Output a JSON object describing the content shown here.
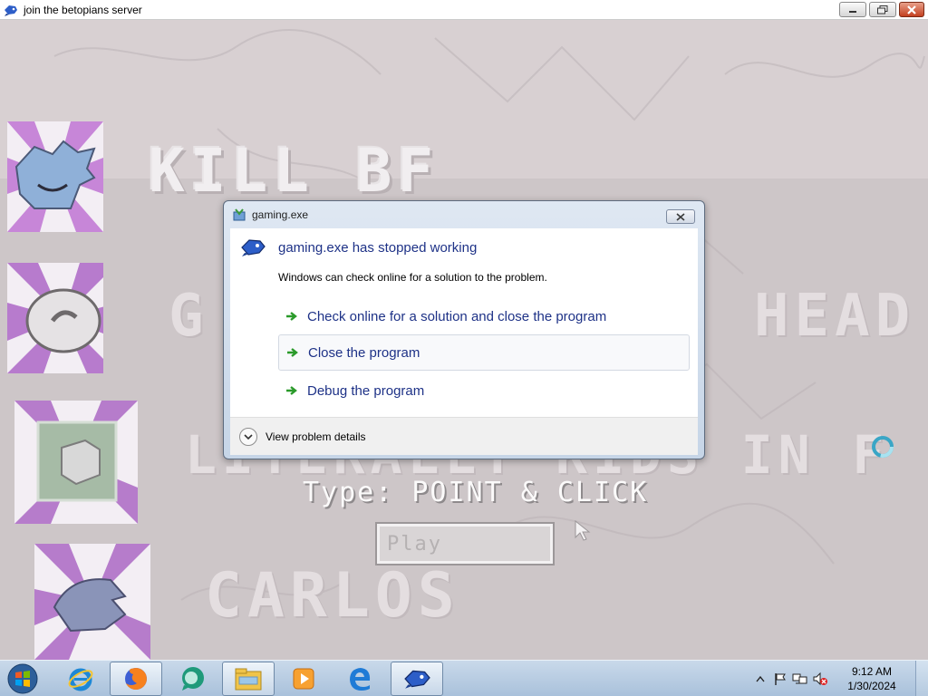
{
  "window": {
    "title": "join the betopians server",
    "controls": [
      "minimize",
      "maximize",
      "close"
    ]
  },
  "game": {
    "menu_items": [
      {
        "label": "KILL BF",
        "icon": "boyfriend-face-icon"
      },
      {
        "label": "G",
        "suffix": "HEAD",
        "icon": "ghost-head-icon"
      },
      {
        "label": "LITERALLY KIDS IN F",
        "icon": "cube-character-icon"
      },
      {
        "label": "CARLOS",
        "icon": "blue-hedgehog-icon"
      }
    ],
    "type_label": "Type: POINT & CLICK",
    "play_label": "Play"
  },
  "dialog": {
    "title": "gaming.exe",
    "heading": "gaming.exe has stopped working",
    "description": "Windows can check online for a solution to the problem.",
    "options": [
      "Check online for a solution and close the program",
      "Close the program",
      "Debug the program"
    ],
    "details_label": "View problem details"
  },
  "taskbar": {
    "items": [
      {
        "name": "ie",
        "icon": "internet-explorer-icon"
      },
      {
        "name": "firefox",
        "icon": "firefox-icon"
      },
      {
        "name": "messenger",
        "icon": "green-chat-icon"
      },
      {
        "name": "explorer",
        "icon": "file-explorer-icon"
      },
      {
        "name": "media-player",
        "icon": "media-player-icon"
      },
      {
        "name": "edge",
        "icon": "edge-icon"
      },
      {
        "name": "game",
        "icon": "blue-bird-icon"
      }
    ],
    "clock": {
      "time": "9:12 AM",
      "date": "1/30/2024"
    }
  },
  "colors": {
    "link_blue": "#1e3287",
    "arrow_green": "#2a9a2a",
    "menu_purple": "#b070c8"
  }
}
